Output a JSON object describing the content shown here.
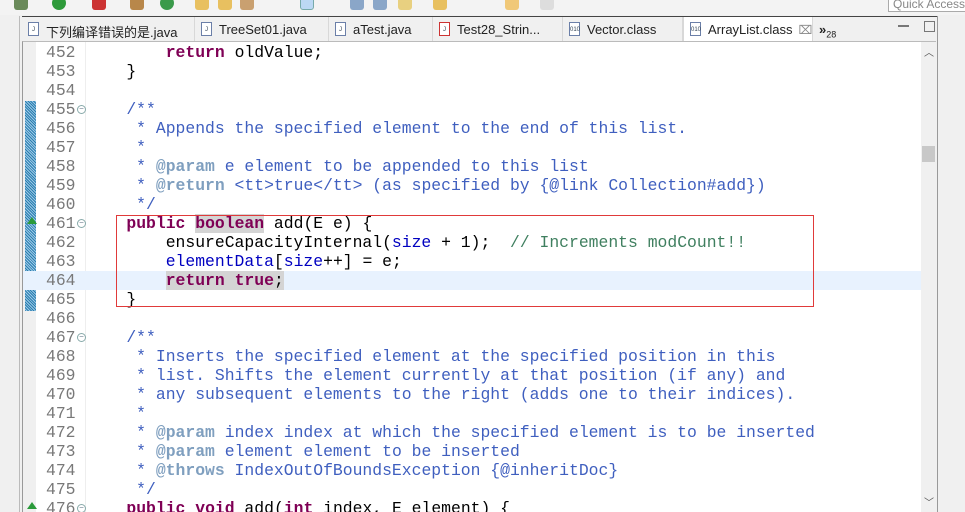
{
  "toolbar": {
    "quick_access": "Quick Access"
  },
  "tabs": [
    {
      "label": "下列编译错误的是.java",
      "icon": "java-file-icon"
    },
    {
      "label": "TreeSet01.java",
      "icon": "java-file-icon"
    },
    {
      "label": "aTest.java",
      "icon": "java-file-icon"
    },
    {
      "label": "Test28_Strin...",
      "icon": "java-file-error-icon"
    },
    {
      "label": "Vector.class",
      "icon": "class-file-icon"
    },
    {
      "label": "ArrayList.class",
      "icon": "class-file-icon",
      "active": true,
      "close": "⌧"
    }
  ],
  "overflow": {
    "label": "»",
    "count": "28"
  },
  "editor": {
    "current_line": "464",
    "lines": [
      {
        "n": "452",
        "s": [
          [
            "",
            "        "
          ],
          [
            "k",
            "return"
          ],
          [
            "",
            " oldValue;"
          ]
        ]
      },
      {
        "n": "453",
        "s": [
          [
            "",
            "    }"
          ]
        ]
      },
      {
        "n": "454",
        "s": []
      },
      {
        "n": "455",
        "fold": true,
        "s": [
          [
            "c",
            "    /**"
          ]
        ]
      },
      {
        "n": "456",
        "s": [
          [
            "c",
            "     * Appends the specified element to the end of this list."
          ]
        ]
      },
      {
        "n": "457",
        "s": [
          [
            "c",
            "     *"
          ]
        ]
      },
      {
        "n": "458",
        "s": [
          [
            "c",
            "     * "
          ],
          [
            "t",
            "@param"
          ],
          [
            "c",
            " e element to be appended to this list"
          ]
        ]
      },
      {
        "n": "459",
        "s": [
          [
            "c",
            "     * "
          ],
          [
            "t",
            "@return"
          ],
          [
            "c",
            " <tt>true</tt> (as specified by {@link Collection#add})"
          ]
        ]
      },
      {
        "n": "460",
        "s": [
          [
            "c",
            "     */"
          ]
        ]
      },
      {
        "n": "461",
        "fold": true,
        "override": true,
        "s": [
          [
            "",
            "    "
          ],
          [
            "k",
            "public"
          ],
          [
            "",
            " "
          ],
          [
            "kh",
            "boolean"
          ],
          [
            "",
            " add(E e) {"
          ]
        ]
      },
      {
        "n": "462",
        "s": [
          [
            "",
            "        ensureCapacityInternal("
          ],
          [
            "f",
            "size"
          ],
          [
            "",
            " + 1);  "
          ],
          [
            "g",
            "// Increments modCount!!"
          ]
        ]
      },
      {
        "n": "463",
        "s": [
          [
            "",
            "        "
          ],
          [
            "f",
            "elementData"
          ],
          [
            "",
            "["
          ],
          [
            "f",
            "size"
          ],
          [
            "",
            "++] = e;"
          ]
        ]
      },
      {
        "n": "464",
        "s": [
          [
            "",
            "        "
          ],
          [
            "kh",
            "return"
          ],
          [
            "h",
            " "
          ],
          [
            "kh",
            "true"
          ],
          [
            "h",
            ";"
          ]
        ]
      },
      {
        "n": "465",
        "s": [
          [
            "",
            "    }"
          ]
        ]
      },
      {
        "n": "466",
        "s": []
      },
      {
        "n": "467",
        "fold": true,
        "s": [
          [
            "c",
            "    /**"
          ]
        ]
      },
      {
        "n": "468",
        "s": [
          [
            "c",
            "     * Inserts the specified element at the specified position in this"
          ]
        ]
      },
      {
        "n": "469",
        "s": [
          [
            "c",
            "     * list. Shifts the element currently at that position (if any) and"
          ]
        ]
      },
      {
        "n": "470",
        "s": [
          [
            "c",
            "     * any subsequent elements to the right (adds one to their indices)."
          ]
        ]
      },
      {
        "n": "471",
        "s": [
          [
            "c",
            "     *"
          ]
        ]
      },
      {
        "n": "472",
        "s": [
          [
            "c",
            "     * "
          ],
          [
            "t",
            "@param"
          ],
          [
            "c",
            " index index at which the specified element is to be inserted"
          ]
        ]
      },
      {
        "n": "473",
        "s": [
          [
            "c",
            "     * "
          ],
          [
            "t",
            "@param"
          ],
          [
            "c",
            " element element to be inserted"
          ]
        ]
      },
      {
        "n": "474",
        "s": [
          [
            "c",
            "     * "
          ],
          [
            "t",
            "@throws"
          ],
          [
            "c",
            " IndexOutOfBoundsException {@inheritDoc}"
          ]
        ]
      },
      {
        "n": "475",
        "s": [
          [
            "c",
            "     */"
          ]
        ]
      },
      {
        "n": "476",
        "fold": true,
        "override": true,
        "s": [
          [
            "",
            "    "
          ],
          [
            "k",
            "public"
          ],
          [
            "",
            " "
          ],
          [
            "k",
            "void"
          ],
          [
            "",
            " add("
          ],
          [
            "k",
            "int"
          ],
          [
            "",
            " index, E element) {"
          ]
        ]
      }
    ]
  },
  "colors": {
    "keyword": "#7f0055",
    "javadoc": "#3f5fbf",
    "javadoc_tag": "#7f9fbf",
    "field": "#0000c0",
    "line_comment": "#3f7f5f",
    "highlight_box": "#e03a3a"
  }
}
